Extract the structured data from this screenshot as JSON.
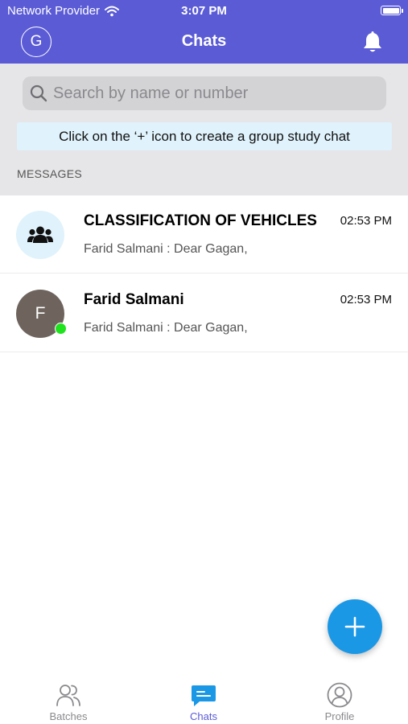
{
  "status_bar": {
    "carrier": "Network Provider",
    "time": "3:07 PM"
  },
  "header": {
    "avatar_initial": "G",
    "title": "Chats"
  },
  "search": {
    "placeholder": "Search by name or number"
  },
  "hint": {
    "text": "Click on the ‘+’ icon to create a group study chat"
  },
  "section": {
    "label": "MESSAGES"
  },
  "chats": [
    {
      "title": "CLASSIFICATION OF VEHICLES",
      "time": "02:53 PM",
      "preview": "Farid Salmani : Dear Gagan,",
      "avatar_icon": "group-icon"
    },
    {
      "title": "Farid Salmani",
      "time": "02:53 PM",
      "preview": "Farid Salmani : Dear Gagan,",
      "avatar_initial": "F",
      "online": true
    }
  ],
  "tabs": [
    {
      "label": "Batches",
      "icon": "batches-icon",
      "active": false
    },
    {
      "label": "Chats",
      "icon": "chat-icon",
      "active": true
    },
    {
      "label": "Profile",
      "icon": "profile-icon",
      "active": false
    }
  ],
  "colors": {
    "header_bg": "#5b5bd6",
    "accent": "#1a98e6",
    "online": "#1fe31f",
    "hint_bg": "#e0f2fb"
  }
}
